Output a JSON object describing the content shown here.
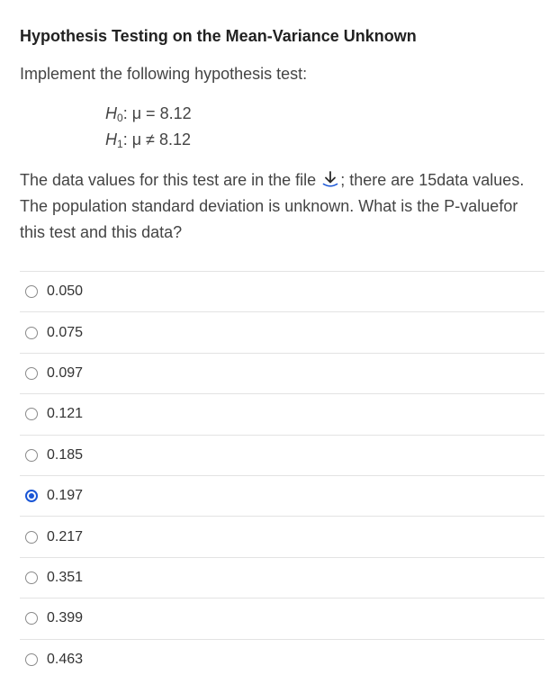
{
  "question": {
    "title": "Hypothesis Testing on the Mean-Variance Unknown",
    "instruction": "Implement the following hypothesis test:",
    "h0": {
      "symbol": "H",
      "sub": "0",
      "statement": ": μ = 8.12"
    },
    "h1": {
      "symbol": "H",
      "sub": "1",
      "statement": ": μ ≠ 8.12"
    },
    "paragraph_before_icon": "The data values for this test are in the file ",
    "download_icon": "download-icon",
    "paragraph_after_icon": "; there are 15data values. The population standard deviation is unknown. What is the P-valuefor this test and this data?"
  },
  "options": [
    {
      "label": "0.050",
      "selected": false
    },
    {
      "label": "0.075",
      "selected": false
    },
    {
      "label": "0.097",
      "selected": false
    },
    {
      "label": "0.121",
      "selected": false
    },
    {
      "label": "0.185",
      "selected": false
    },
    {
      "label": "0.197",
      "selected": true
    },
    {
      "label": "0.217",
      "selected": false
    },
    {
      "label": "0.351",
      "selected": false
    },
    {
      "label": "0.399",
      "selected": false
    },
    {
      "label": "0.463",
      "selected": false
    }
  ],
  "colors": {
    "accent": "#1a56d6",
    "divider": "#e3e3e3",
    "text": "#444444"
  }
}
